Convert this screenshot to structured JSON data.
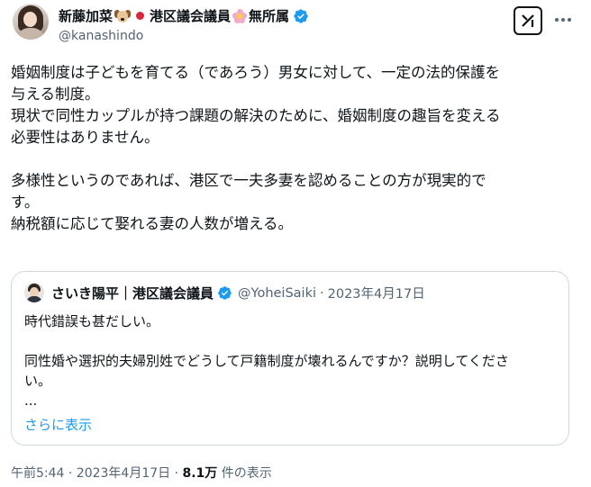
{
  "author": {
    "name_part1": "新藤加菜",
    "name_part2": "港区議会議員",
    "name_part3": "無所属",
    "handle": "@kanashindo",
    "icons": [
      "dog-face-emoji",
      "red-circle-flag",
      "cherry-blossom-emoji",
      "verified-badge"
    ]
  },
  "tweet": {
    "lines": [
      "婚姻制度は子どもを育てる（であろう）男女に対して、一定の法的保護を",
      "与える制度。",
      "現状で同性カップルが持つ課題の解決のために、婚姻制度の趣旨を変える",
      "必要性はありません。",
      "",
      "多様性というのであれば、港区で一夫多妻を認めることの方が現実的で",
      "す。",
      "納税額に応じて娶れる妻の人数が増える。"
    ]
  },
  "quote": {
    "name": "さいき陽平｜港区議会議員",
    "handle": "@YoheiSaiki",
    "separator": "·",
    "date": "2023年4月17日",
    "lines": [
      "時代錯誤も甚だしい。",
      "",
      "同性婚や選択的夫婦別姓でどうして戸籍制度が壊れるんですか？説明してくださ",
      "い。",
      "..."
    ],
    "show_more": "さらに表示"
  },
  "footer": {
    "time": "午前5:44 · 2023年4月17日 · ",
    "views_count": "8.1万",
    "views_label": " 件の表示"
  },
  "colors": {
    "text": "#0f1419",
    "secondary": "#536471",
    "link": "#1d9bf0",
    "verified": "#1d9bf0",
    "border": "#cfd9de"
  }
}
